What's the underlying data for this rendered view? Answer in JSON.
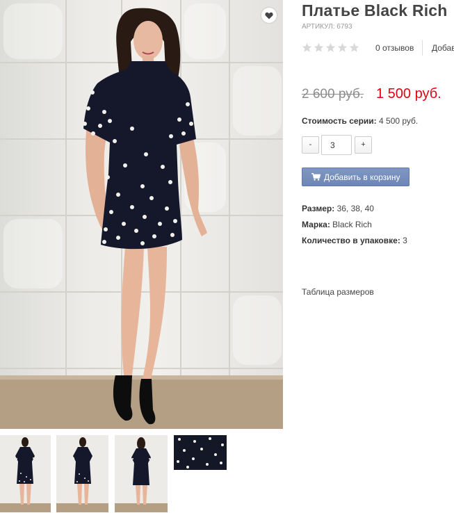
{
  "product": {
    "title": "Платье Black Rich",
    "sku": "АРТИКУЛ: 6793",
    "reviews_count": "0 отзывов",
    "add_review": "Добав",
    "rating_stars": 5,
    "rating_value": 0,
    "old_price": "2 600 руб.",
    "new_price": "1 500 руб.",
    "series_cost_label": "Стоимость серии:",
    "series_cost_value": "4 500 руб.",
    "qty_minus": "-",
    "qty_value": "3",
    "qty_plus": "+",
    "add_to_cart": "Добавить в корзину",
    "size_label": "Размер:",
    "size_value": "36, 38, 40",
    "brand_label": "Марка:",
    "brand_value": "Black Rich",
    "pack_label": "Количество в упаковке:",
    "pack_value": "3",
    "size_table": "Таблица размеров"
  },
  "icons": {
    "wishlist": "heart-icon",
    "cart": "cart-icon",
    "rating": "star-icon"
  },
  "colors": {
    "price_new": "#e3000f",
    "price_old": "#8c8c8c",
    "button_primary": "#7289ba",
    "dress": "#15182a",
    "pearls": "#f2f0ea"
  }
}
